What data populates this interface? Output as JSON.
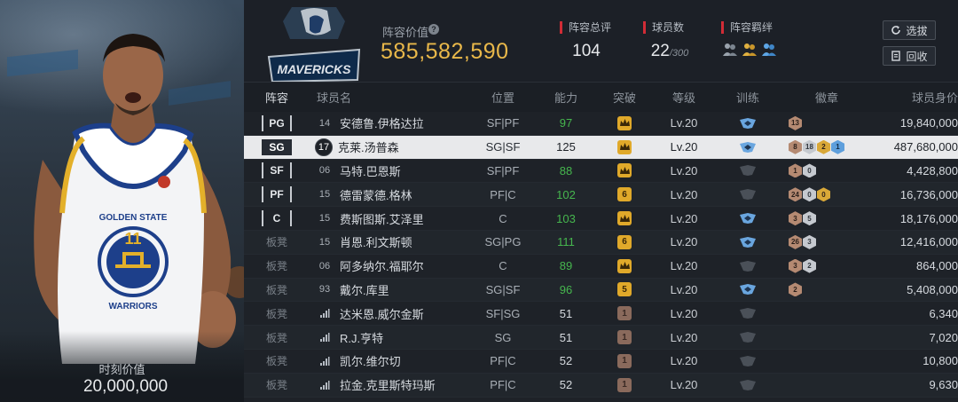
{
  "player_card": {
    "value_label": "时刻价值",
    "value_amount": "20,000,000",
    "team_text": "GOLDEN STATE",
    "team_text_2": "WARRIORS",
    "jersey_number": "11"
  },
  "header": {
    "team_logo_text": "MAVERICKS",
    "lineup_value_label": "阵容价值",
    "lineup_value": "585,582,590",
    "overall_label": "阵容总评",
    "overall_value": "104",
    "count_label": "球员数",
    "count_value": "22",
    "count_max": "/300",
    "bond_label": "阵容羁绊",
    "filter_button": "选拔",
    "recycle_button": "回收",
    "icons": {
      "help": "question-circle-icon",
      "filter": "refresh-icon",
      "recycle": "document-icon",
      "bond": "people-icon"
    }
  },
  "table": {
    "headers": {
      "lineup": "阵容",
      "name": "球员名",
      "position": "位置",
      "ability": "能力",
      "breakthrough": "突破",
      "level": "等级",
      "training": "训练",
      "badges": "徽章",
      "value": "球员身价"
    },
    "rows": [
      {
        "slot": "PG",
        "number": "14",
        "name": "安德鲁.伊格达拉",
        "position": "SF|PF",
        "ability": "97",
        "breakthrough": "crown",
        "level": "Lv.20",
        "training": "blue",
        "badges": [
          [
            "bronze",
            "13"
          ]
        ],
        "value": "19,840,000"
      },
      {
        "slot": "SG",
        "number": "17",
        "name": "克莱.汤普森",
        "position": "SG|SF",
        "ability": "125",
        "breakthrough": "crown",
        "level": "Lv.20",
        "training": "blue",
        "badges": [
          [
            "bronze",
            "8"
          ],
          [
            "silver",
            "18"
          ],
          [
            "gold",
            "2"
          ],
          [
            "blue",
            "1"
          ]
        ],
        "value": "487,680,000"
      },
      {
        "slot": "SF",
        "number": "06",
        "name": "马特.巴恩斯",
        "position": "SF|PF",
        "ability": "88",
        "breakthrough": "crown",
        "level": "Lv.20",
        "training": "dim",
        "badges": [
          [
            "bronze",
            "1"
          ],
          [
            "silver",
            "0"
          ]
        ],
        "value": "4,428,800"
      },
      {
        "slot": "PF",
        "number": "15",
        "name": "德雷蒙德.格林",
        "position": "PF|C",
        "ability": "102",
        "breakthrough": "6",
        "level": "Lv.20",
        "training": "dim",
        "badges": [
          [
            "bronze",
            "24"
          ],
          [
            "silver",
            "0"
          ],
          [
            "gold",
            "0"
          ]
        ],
        "value": "16,736,000"
      },
      {
        "slot": "C",
        "number": "15",
        "name": "费斯图斯.艾泽里",
        "position": "C",
        "ability": "103",
        "breakthrough": "crown",
        "level": "Lv.20",
        "training": "blue",
        "badges": [
          [
            "bronze",
            "3"
          ],
          [
            "silver",
            "5"
          ]
        ],
        "value": "18,176,000"
      },
      {
        "slot": "板凳",
        "number": "15",
        "name": "肖恩.利文斯顿",
        "position": "SG|PG",
        "ability": "111",
        "breakthrough": "6",
        "level": "Lv.20",
        "training": "blue",
        "badges": [
          [
            "bronze",
            "26"
          ],
          [
            "silver",
            "3"
          ]
        ],
        "value": "12,416,000"
      },
      {
        "slot": "板凳",
        "number": "06",
        "name": "阿多纳尔.福耶尔",
        "position": "C",
        "ability": "89",
        "breakthrough": "crown",
        "level": "Lv.20",
        "training": "dim",
        "badges": [
          [
            "bronze",
            "3"
          ],
          [
            "silver",
            "2"
          ]
        ],
        "value": "864,000"
      },
      {
        "slot": "板凳",
        "number": "93",
        "name": "戴尔.库里",
        "position": "SG|SF",
        "ability": "96",
        "breakthrough": "5",
        "level": "Lv.20",
        "training": "blue",
        "badges": [
          [
            "bronze",
            "2"
          ]
        ],
        "value": "5,408,000"
      },
      {
        "slot": "板凳",
        "number": "",
        "name": "达米恩.威尔金斯",
        "position": "SF|SG",
        "ability": "51",
        "breakthrough": "1",
        "level": "Lv.20",
        "training": "dim",
        "badges": [],
        "value": "6,340"
      },
      {
        "slot": "板凳",
        "number": "",
        "name": "R.J.亨特",
        "position": "SG",
        "ability": "51",
        "breakthrough": "1",
        "level": "Lv.20",
        "training": "dim",
        "badges": [],
        "value": "7,020"
      },
      {
        "slot": "板凳",
        "number": "",
        "name": "凯尔.维尔切",
        "position": "PF|C",
        "ability": "52",
        "breakthrough": "1",
        "level": "Lv.20",
        "training": "dim",
        "badges": [],
        "value": "10,800"
      },
      {
        "slot": "板凳",
        "number": "",
        "name": "拉金.克里斯特玛斯",
        "position": "PF|C",
        "ability": "52",
        "breakthrough": "1",
        "level": "Lv.20",
        "training": "dim",
        "badges": [],
        "value": "9,630"
      }
    ]
  },
  "colors": {
    "gold": "#e9b84a",
    "green": "#46b64e",
    "red_accent": "#d12c36",
    "selected_row": "#e8e9eb"
  }
}
